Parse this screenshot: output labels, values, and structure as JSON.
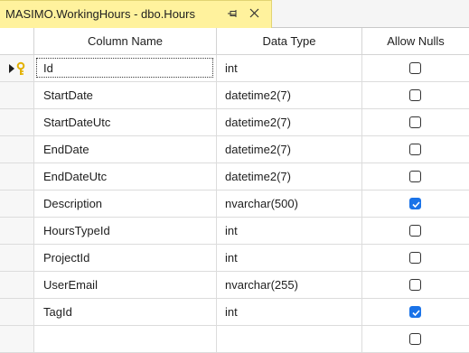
{
  "tab": {
    "title": "MASIMO.WorkingHours - dbo.Hours"
  },
  "columns": {
    "name": "Column Name",
    "type": "Data Type",
    "nulls": "Allow Nulls"
  },
  "rows": [
    {
      "name": "Id",
      "type": "int",
      "allow_nulls": false
    },
    {
      "name": "StartDate",
      "type": "datetime2(7)",
      "allow_nulls": false
    },
    {
      "name": "StartDateUtc",
      "type": "datetime2(7)",
      "allow_nulls": false
    },
    {
      "name": "EndDate",
      "type": "datetime2(7)",
      "allow_nulls": false
    },
    {
      "name": "EndDateUtc",
      "type": "datetime2(7)",
      "allow_nulls": false
    },
    {
      "name": "Description",
      "type": "nvarchar(500)",
      "allow_nulls": true
    },
    {
      "name": "HoursTypeId",
      "type": "int",
      "allow_nulls": false
    },
    {
      "name": "ProjectId",
      "type": "int",
      "allow_nulls": false
    },
    {
      "name": "UserEmail",
      "type": "nvarchar(255)",
      "allow_nulls": false
    },
    {
      "name": "TagId",
      "type": "int",
      "allow_nulls": true
    },
    {
      "name": "",
      "type": "",
      "allow_nulls": false
    }
  ],
  "current_row": 0,
  "icons": {
    "row_indicator": "primary-key-arrow-icon",
    "pin": "pin-icon",
    "close": "close-icon"
  },
  "colors": {
    "tab_active": "#fff29d",
    "checkbox_checked": "#1a73e8",
    "key_gold": "#e3b100"
  }
}
